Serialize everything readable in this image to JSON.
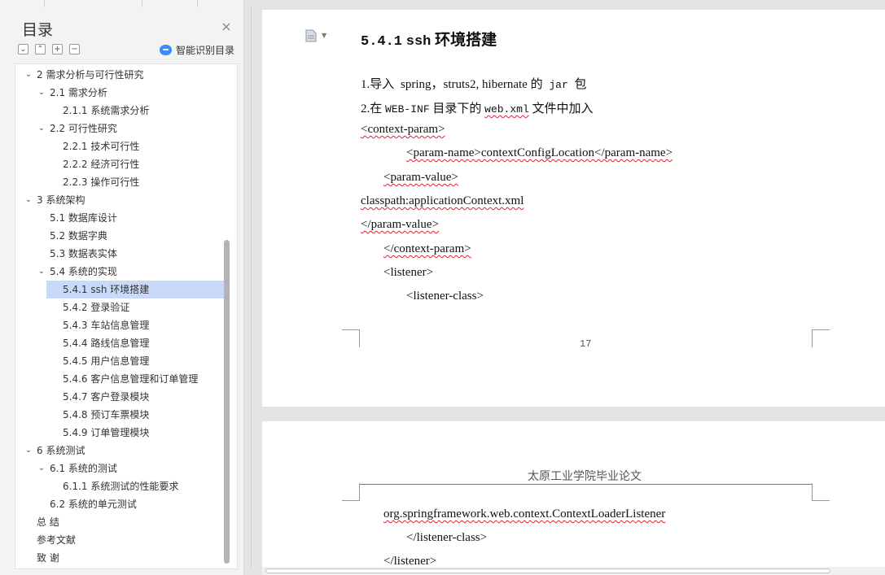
{
  "sidebar": {
    "title": "目录",
    "close_label": "×",
    "tools": [
      "⌄",
      "⌃",
      "+",
      "−"
    ],
    "smart_label": "智能识别目录",
    "toc": [
      {
        "label": "2  需求分析与可行性研究",
        "indent": 0,
        "chevron": "⌄"
      },
      {
        "label": "2.1 需求分析",
        "indent": 1,
        "chevron": "⌄"
      },
      {
        "label": "2.1.1 系统需求分析",
        "indent": 2,
        "chevron": ""
      },
      {
        "label": "2.2 可行性研究",
        "indent": 1,
        "chevron": "⌄"
      },
      {
        "label": "2.2.1 技术可行性",
        "indent": 2,
        "chevron": ""
      },
      {
        "label": "2.2.2 经济可行性",
        "indent": 2,
        "chevron": ""
      },
      {
        "label": "2.2.3 操作可行性",
        "indent": 2,
        "chevron": ""
      },
      {
        "label": "3 系统架构",
        "indent": 0,
        "chevron": "⌄"
      },
      {
        "label": "5.1 数据库设计",
        "indent": 1,
        "chevron": ""
      },
      {
        "label": "5.2 数据字典",
        "indent": 1,
        "chevron": ""
      },
      {
        "label": "5.3  数据表实体",
        "indent": 1,
        "chevron": ""
      },
      {
        "label": "5.4 系统的实现",
        "indent": 1,
        "chevron": "⌄"
      },
      {
        "label": "5.4.1 ssh 环境搭建",
        "indent": 2,
        "chevron": "",
        "selected": true
      },
      {
        "label": "5.4.2 登录验证",
        "indent": 2,
        "chevron": ""
      },
      {
        "label": "5.4.3 车站信息管理",
        "indent": 2,
        "chevron": ""
      },
      {
        "label": "5.4.4 路线信息管理",
        "indent": 2,
        "chevron": ""
      },
      {
        "label": "5.4.5 用户信息管理",
        "indent": 2,
        "chevron": ""
      },
      {
        "label": "5.4.6 客户信息管理和订单管理",
        "indent": 2,
        "chevron": ""
      },
      {
        "label": "5.4.7 客户登录模块",
        "indent": 2,
        "chevron": ""
      },
      {
        "label": "5.4.8 预订车票模块",
        "indent": 2,
        "chevron": ""
      },
      {
        "label": "5.4.9  订单管理模块",
        "indent": 2,
        "chevron": ""
      },
      {
        "label": "6  系统测试",
        "indent": 0,
        "chevron": "⌄"
      },
      {
        "label": "6.1 系统的测试",
        "indent": 1,
        "chevron": "⌄"
      },
      {
        "label": "6.1.1 系统测试的性能要求",
        "indent": 2,
        "chevron": ""
      },
      {
        "label": "6.2 系统的单元测试",
        "indent": 1,
        "chevron": ""
      },
      {
        "label": "总    结",
        "indent": -1,
        "chevron": ""
      },
      {
        "label": "参考文献",
        "indent": -1,
        "chevron": ""
      },
      {
        "label": "致    谢",
        "indent": -1,
        "chevron": ""
      }
    ]
  },
  "document": {
    "heading_num": "5.4.1",
    "heading_ssh": "ssh",
    "heading_text": "环境搭建",
    "page_number": "17",
    "page2_header": "太原工业学院毕业论文",
    "lines": {
      "l1_a": "1.导入",
      "l1_b": "spring，struts2, hibernate",
      "l1_c": "的",
      "l1_d": "jar",
      "l1_e": "包",
      "l2_a": "2.在",
      "l2_b": "WEB-INF",
      "l2_c": "目录下的",
      "l2_d": "web.xml",
      "l2_e": "文件中加入",
      "l3": "<context-param>",
      "l4": "<param-name>contextConfigLocation</param-name>",
      "l5": "<param-value>",
      "l6": "classpath:applicationContext.xml",
      "l7": "</param-value>",
      "l8": "</context-param>",
      "l9": "<listener>",
      "l10": "<listener-class>",
      "p2_l1": "org.springframework.web.context.ContextLoaderListener",
      "p2_l2": "</listener-class>",
      "p2_l3": "</listener>"
    }
  }
}
